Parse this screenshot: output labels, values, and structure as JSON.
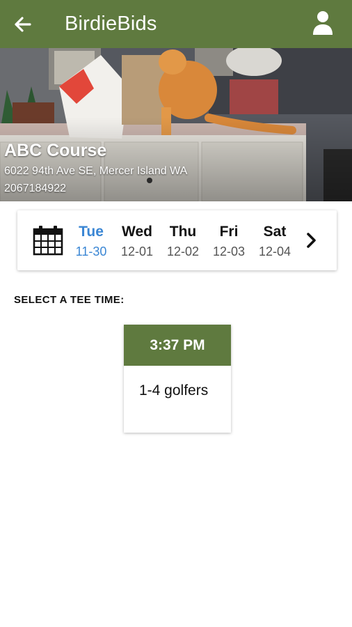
{
  "app": {
    "title": "BirdieBids",
    "brand_color": "#5f7a3f",
    "accent_color": "#3a86d4"
  },
  "header": {
    "back_icon": "arrow-left-icon",
    "account_icon": "user-icon"
  },
  "course": {
    "name": "ABC Course",
    "address": "6022 94th Ave SE, Mercer Island WA",
    "phone": "2067184922"
  },
  "date_picker": {
    "calendar_icon": "calendar-icon",
    "next_icon": "chevron-right-icon",
    "days": [
      {
        "name": "Tue",
        "date": "11-30",
        "selected": true
      },
      {
        "name": "Wed",
        "date": "12-01",
        "selected": false
      },
      {
        "name": "Thu",
        "date": "12-02",
        "selected": false
      },
      {
        "name": "Fri",
        "date": "12-03",
        "selected": false
      },
      {
        "name": "Sat",
        "date": "12-04",
        "selected": false
      }
    ]
  },
  "tee_times": {
    "label": "SELECT A TEE TIME:",
    "slots": [
      {
        "time": "3:37 PM",
        "golfers": "1-4 golfers"
      }
    ]
  }
}
